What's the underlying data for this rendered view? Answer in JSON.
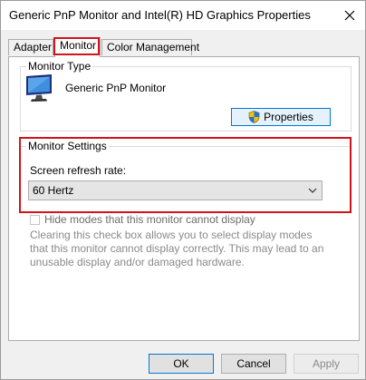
{
  "window": {
    "title": "Generic PnP Monitor and Intel(R) HD Graphics Properties"
  },
  "tabs": [
    {
      "label": "Adapter",
      "active": false
    },
    {
      "label": "Monitor",
      "active": true
    },
    {
      "label": "Color Management",
      "active": false
    }
  ],
  "monitor_type": {
    "label": "Monitor Type",
    "monitor_name": "Generic PnP Monitor",
    "properties_label": "Properties"
  },
  "monitor_settings": {
    "label": "Monitor Settings",
    "refresh_label": "Screen refresh rate:",
    "refresh_value": "60 Hertz",
    "hide_modes_label": "Hide modes that this monitor cannot display",
    "hide_modes_checked": false,
    "description": "Clearing this check box allows you to select display modes that this monitor cannot display correctly. This may lead to an unusable display and/or damaged hardware."
  },
  "buttons": {
    "ok": "OK",
    "cancel": "Cancel",
    "apply": "Apply"
  },
  "colors": {
    "highlight": "#d0141a",
    "accent": "#0078d7",
    "dialog_bg": "#f0f0f0"
  },
  "icons": {
    "close": "close-icon",
    "monitor": "monitor-icon",
    "shield": "shield-icon",
    "dropdown": "chevron-down-icon"
  }
}
